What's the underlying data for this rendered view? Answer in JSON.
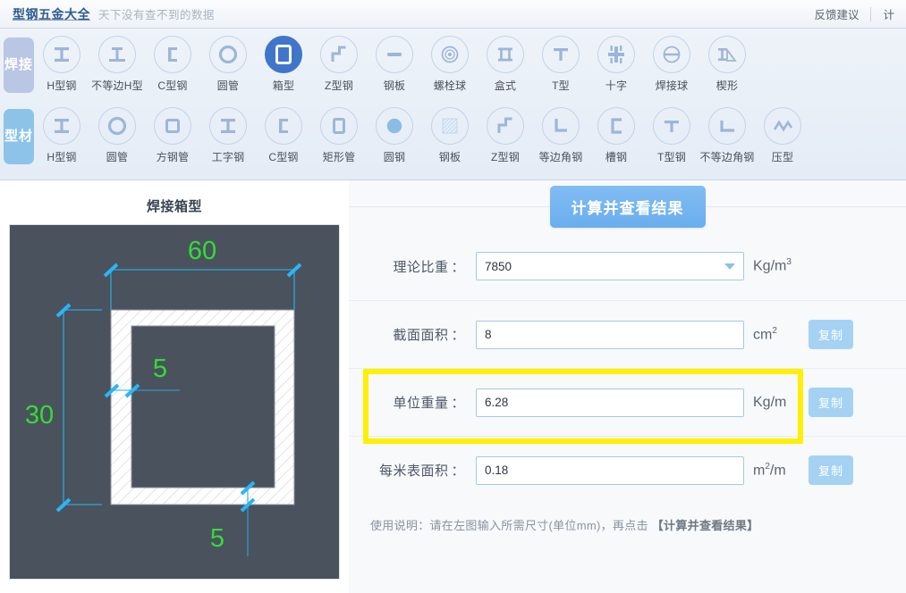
{
  "header": {
    "brand": "型钢五金大全",
    "slogan": "天下没有查不到的数据",
    "links": [
      "反馈建议",
      "计"
    ]
  },
  "toolbar": {
    "categories": [
      {
        "name": "焊接",
        "items": [
          {
            "label": "H型钢",
            "icon": "h-beam-icon",
            "selected": false
          },
          {
            "label": "不等边H型",
            "icon": "unequal-h-beam-icon",
            "selected": false
          },
          {
            "label": "C型钢",
            "icon": "c-channel-icon",
            "selected": false
          },
          {
            "label": "圆管",
            "icon": "round-pipe-icon",
            "selected": false
          },
          {
            "label": "箱型",
            "icon": "box-section-icon",
            "selected": true
          },
          {
            "label": "Z型钢",
            "icon": "z-beam-icon",
            "selected": false
          },
          {
            "label": "钢板",
            "icon": "steel-plate-icon",
            "selected": false
          },
          {
            "label": "螺栓球",
            "icon": "bolt-ball-icon",
            "selected": false
          },
          {
            "label": "盒式",
            "icon": "box-type-icon",
            "selected": false
          },
          {
            "label": "T型",
            "icon": "t-section-icon",
            "selected": false
          },
          {
            "label": "十字",
            "icon": "cross-section-icon",
            "selected": false
          },
          {
            "label": "焊接球",
            "icon": "welded-ball-icon",
            "selected": false
          },
          {
            "label": "楔形",
            "icon": "wedge-icon",
            "selected": false
          }
        ]
      },
      {
        "name": "型材",
        "items": [
          {
            "label": "H型钢",
            "icon": "h-beam-icon",
            "selected": false
          },
          {
            "label": "圆管",
            "icon": "round-pipe-icon",
            "selected": false
          },
          {
            "label": "方钢管",
            "icon": "square-pipe-icon",
            "selected": false
          },
          {
            "label": "工字钢",
            "icon": "i-beam-icon",
            "selected": false
          },
          {
            "label": "C型钢",
            "icon": "c-channel-icon",
            "selected": false
          },
          {
            "label": "矩形管",
            "icon": "rect-pipe-icon",
            "selected": false
          },
          {
            "label": "圆钢",
            "icon": "round-bar-icon",
            "selected": false
          },
          {
            "label": "钢板",
            "icon": "steel-plate-hatch-icon",
            "selected": false
          },
          {
            "label": "Z型钢",
            "icon": "z-beam-icon",
            "selected": false
          },
          {
            "label": "等边角钢",
            "icon": "equal-angle-icon",
            "selected": false
          },
          {
            "label": "槽钢",
            "icon": "channel-icon",
            "selected": false
          },
          {
            "label": "T型钢",
            "icon": "t-beam-icon",
            "selected": false
          },
          {
            "label": "不等边角钢",
            "icon": "unequal-angle-icon",
            "selected": false
          },
          {
            "label": "压型",
            "icon": "profiled-icon",
            "selected": false
          }
        ]
      }
    ]
  },
  "shape": {
    "title": "焊接箱型",
    "diagram": {
      "outer_width_label": "60",
      "outer_height_label": "30",
      "top_thickness_label": "5",
      "side_thickness_label": "5",
      "dimension_color": "#33dd33",
      "leader_color": "#2aa8d8",
      "background": "#4a525e",
      "hatch_color": "#ffffff"
    }
  },
  "form": {
    "calc_button": "计算并查看结果",
    "rows": [
      {
        "label": "理论比重",
        "value": "7850",
        "unit_base": "Kg/m",
        "unit_sup": "3",
        "type": "select",
        "copy": null,
        "highlighted": false
      },
      {
        "label": "截面面积",
        "value": "8",
        "unit_base": "cm",
        "unit_sup": "2",
        "type": "text",
        "copy": "复制",
        "highlighted": false
      },
      {
        "label": "单位重量",
        "value": "6.28",
        "unit_base": "Kg/m",
        "unit_sup": "",
        "type": "text",
        "copy": "复制",
        "highlighted": true
      },
      {
        "label": "每米表面积",
        "value": "0.18",
        "unit_base": "m",
        "unit_sup": "2",
        "unit_tail": "/m",
        "type": "text",
        "copy": "复制",
        "highlighted": false
      }
    ],
    "hint_prefix": "使用说明：请在左图输入所需尺寸(单位mm)，再点击",
    "hint_strong": "【计算并查看结果】"
  },
  "colors": {
    "accent": "#3f76c9",
    "button": "#6aaeee",
    "highlight": "#ffef00",
    "copy": "#a5d2f3"
  }
}
